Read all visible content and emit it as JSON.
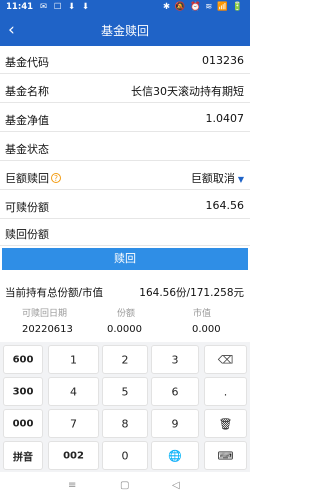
{
  "status": {
    "time": "11:41",
    "left_icons": "✉ ☐ ⬇ ⬇",
    "right_icons": "✱ 🔕 ⏰ ≋ 📶 🔋"
  },
  "nav": {
    "back_icon": "chevron-left-icon",
    "title": "基金赎回"
  },
  "form": {
    "fund_code_label": "基金代码",
    "fund_code_value": "013236",
    "fund_name_label": "基金名称",
    "fund_name_value": "长信30天滚动持有期短",
    "nav_label": "基金净值",
    "nav_value": "1.0407",
    "status_label": "基金状态",
    "status_value": "",
    "large_redeem_label": "巨额赎回",
    "large_redeem_value": "巨额取消",
    "available_label": "可赎份额",
    "available_value": "164.56",
    "redeem_label": "赎回份额",
    "redeem_value": ""
  },
  "redeem_button": "赎回",
  "holding": {
    "label": "当前持有总份额/市值",
    "value": "164.56份/171.258元"
  },
  "table": {
    "headers": [
      "可赎回日期",
      "份额",
      "市值"
    ],
    "rows": [
      [
        "20220613",
        "0.0000",
        "0.000"
      ]
    ]
  },
  "keyboard": {
    "left": [
      "600",
      "300",
      "000",
      "拼音"
    ],
    "digits": [
      "1",
      "2",
      "3",
      "4",
      "5",
      "6",
      "7",
      "8",
      "9"
    ],
    "bottom": [
      "002",
      "0"
    ],
    "right": [
      "⌫",
      ".",
      "🗑",
      "⌨"
    ],
    "globe": "🌐"
  },
  "bottom_nav": [
    "≡",
    "▢",
    "◁"
  ]
}
